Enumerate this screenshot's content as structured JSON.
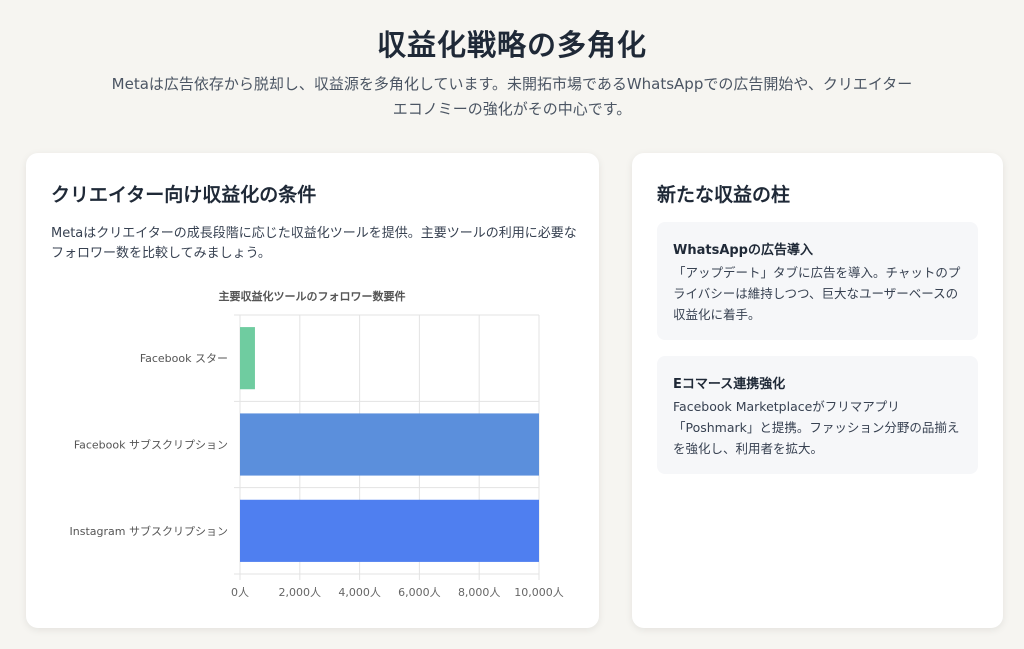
{
  "header": {
    "title": "収益化戦略の多角化",
    "subtitle": "Metaは広告依存から脱却し、収益源を多角化しています。未開拓市場であるWhatsAppでの広告開始や、クリエイターエコノミーの強化がその中心です。"
  },
  "creator_card": {
    "title": "クリエイター向け収益化の条件",
    "description": "Metaはクリエイターの成長段階に応じた収益化ツールを提供。主要ツールの利用に必要なフォロワー数を比較してみましょう。"
  },
  "chart_data": {
    "type": "bar",
    "orientation": "horizontal",
    "title": "主要収益化ツールのフォロワー数要件",
    "categories": [
      "Facebook スター",
      "Facebook サブスクリプション",
      "Instagram サブスクリプション"
    ],
    "values": [
      500,
      10000,
      10000
    ],
    "colors": [
      "#6fcca0",
      "#5b8fdc",
      "#4f7ff0"
    ],
    "xlim": [
      0,
      10000
    ],
    "xticks": [
      0,
      2000,
      4000,
      6000,
      8000,
      10000
    ],
    "xtick_labels": [
      "0人",
      "2,000人",
      "4,000人",
      "6,000人",
      "8,000人",
      "10,000人"
    ],
    "grid": true,
    "legend": "none"
  },
  "revenue_card": {
    "title": "新たな収益の柱",
    "items": [
      {
        "title": "WhatsAppの広告導入",
        "text": "「アップデート」タブに広告を導入。チャットのプライバシーは維持しつつ、巨大なユーザーベースの収益化に着手。"
      },
      {
        "title": "Eコマース連携強化",
        "text": "Facebook Marketplaceがフリマアプリ「Poshmark」と提携。ファッション分野の品揃えを強化し、利用者を拡大。"
      }
    ]
  }
}
